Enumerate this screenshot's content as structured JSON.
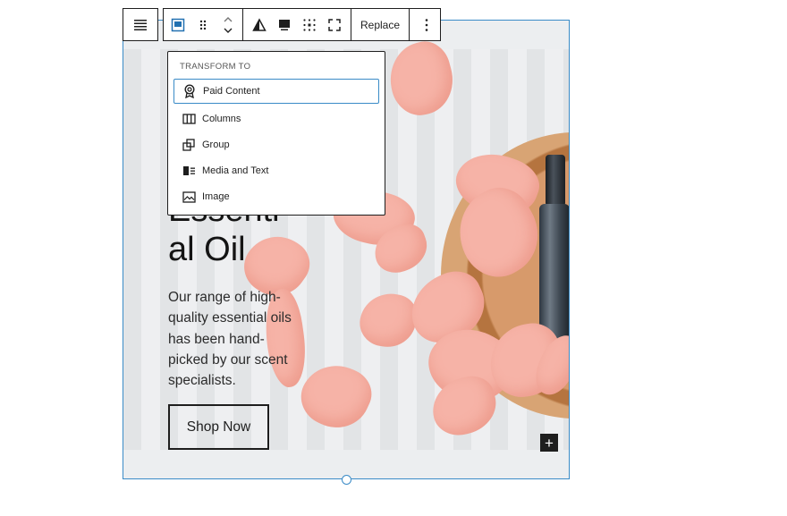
{
  "toolbar": {
    "replace_label": "Replace"
  },
  "transform_menu": {
    "title": "TRANSFORM TO",
    "items": [
      {
        "label": "Paid Content",
        "icon": "award-icon"
      },
      {
        "label": "Columns",
        "icon": "columns-icon"
      },
      {
        "label": "Group",
        "icon": "group-icon"
      },
      {
        "label": "Media and Text",
        "icon": "media-text-icon"
      },
      {
        "label": "Image",
        "icon": "image-icon"
      }
    ]
  },
  "cover": {
    "heading_line1": "Essenti",
    "heading_line2": "al Oil",
    "body": "Our range of high-quality essential oils has been hand-picked by our scent specialists.",
    "button_label": "Shop Now",
    "add_symbol": "+"
  },
  "colors": {
    "selection_blue": "#3a8bc7",
    "petal_pink": "#f6b3a7",
    "toolbar_border": "#1e1e1e"
  }
}
